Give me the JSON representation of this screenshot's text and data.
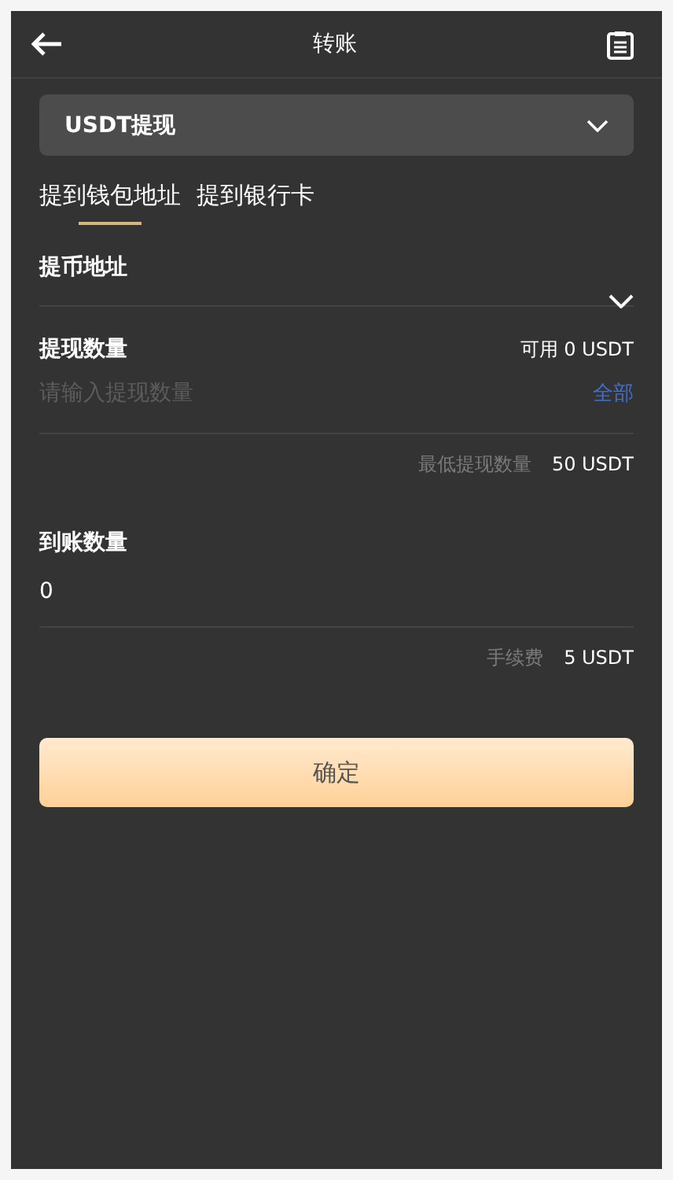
{
  "header": {
    "title": "转账"
  },
  "currency_select": {
    "value": "USDT提现"
  },
  "tabs": [
    {
      "label": "提到钱包地址",
      "selected": true
    },
    {
      "label": "提到银行卡",
      "selected": false
    }
  ],
  "address": {
    "label": "提币地址"
  },
  "amount": {
    "label": "提现数量",
    "available": "可用 0 USDT",
    "placeholder": "请输入提现数量",
    "all_link": "全部",
    "min_label": "最低提现数量",
    "min_value": "50 USDT"
  },
  "arrival": {
    "label": "到账数量",
    "value": "0",
    "fee_label": "手续费",
    "fee_value": "5 USDT"
  },
  "confirm_button": "确定"
}
